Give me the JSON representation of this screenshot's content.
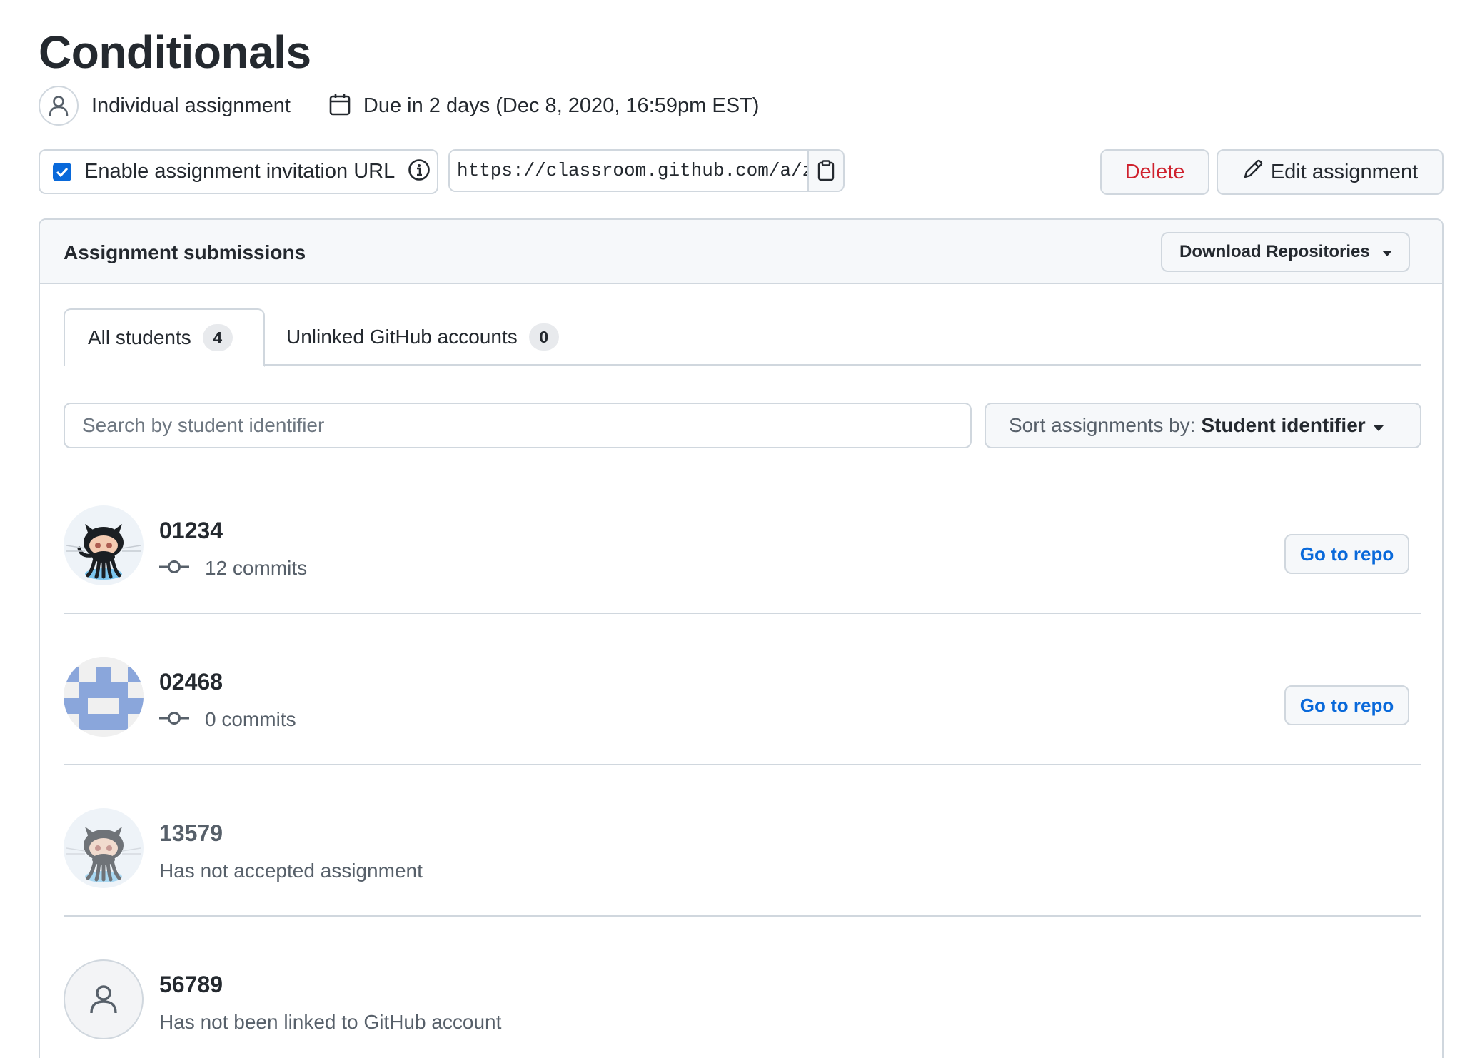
{
  "assignment": {
    "title": "Conditionals",
    "type_label": "Individual assignment",
    "due_label": "Due in 2 days (Dec 8, 2020, 16:59pm EST)"
  },
  "invitation": {
    "enabled": true,
    "label": "Enable assignment invitation URL",
    "url": "https://classroom.github.com/a/zxcvbnm"
  },
  "actions": {
    "delete_label": "Delete",
    "edit_label": "Edit assignment"
  },
  "submissions": {
    "title": "Assignment submissions",
    "download_label": "Download Repositories",
    "tabs": [
      {
        "label": "All students",
        "count": "4",
        "active": true
      },
      {
        "label": "Unlinked GitHub accounts",
        "count": "0",
        "active": false
      }
    ],
    "search_placeholder": "Search by student identifier",
    "sort_label": "Sort assignments by:",
    "sort_value": "Student identifier",
    "go_to_repo_label": "Go to repo",
    "students": [
      {
        "id": "01234",
        "status": "12 commits",
        "avatar": "octocat-icon"
      },
      {
        "id": "02468",
        "status": "0 commits",
        "avatar": "identicon"
      },
      {
        "id": "13579",
        "status": "Has not accepted assignment",
        "avatar": "octocat-faded-icon"
      },
      {
        "id": "56789",
        "status": "Has not been linked to GitHub account",
        "avatar": "person-icon"
      }
    ]
  },
  "colors": {
    "accent": "#0969da",
    "danger": "#cf222e",
    "border": "#d0d7de",
    "muted": "#57606a",
    "identicon": "#8aa6db"
  }
}
